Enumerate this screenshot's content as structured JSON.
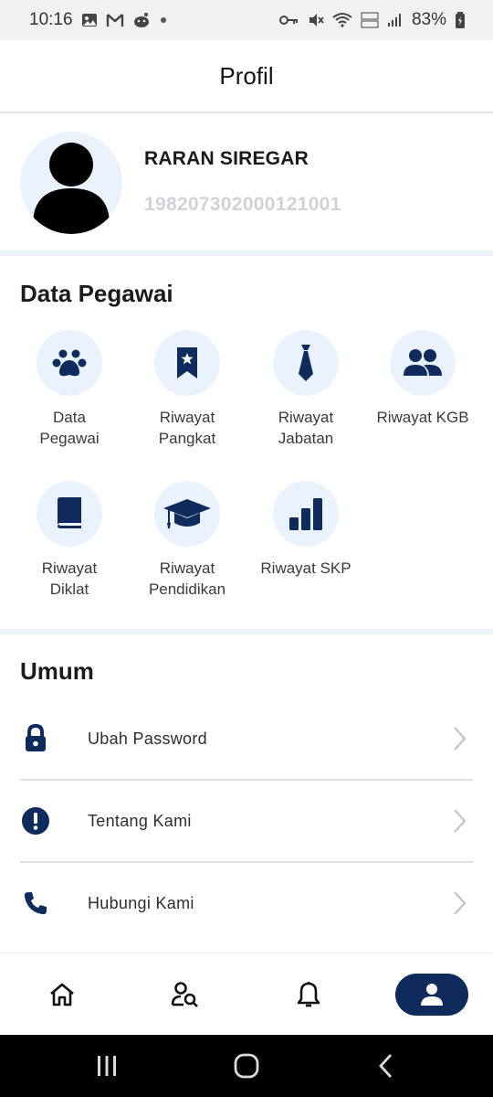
{
  "status_bar": {
    "time": "10:16",
    "battery": "83%",
    "icons_left": [
      "image-icon",
      "gmail-icon",
      "reddit-icon",
      "dot-icon"
    ],
    "icons_right": [
      "key-icon",
      "mute-icon",
      "wifi-icon",
      "volte-icon",
      "signal-icon",
      "battery-icon"
    ]
  },
  "header": {
    "title": "Profil"
  },
  "profile": {
    "name": "RARAN SIREGAR",
    "nip": "198207302000121001"
  },
  "data_pegawai": {
    "title": "Data Pegawai",
    "items": [
      {
        "label_line1": "Data",
        "label_line2": "Pegawai",
        "icon": "paw-icon"
      },
      {
        "label_line1": "Riwayat",
        "label_line2": "Pangkat",
        "icon": "bookmark-star-icon"
      },
      {
        "label_line1": "Riwayat",
        "label_line2": "Jabatan",
        "icon": "tie-icon"
      },
      {
        "label_line1": "Riwayat KGB",
        "label_line2": "",
        "icon": "users-icon"
      },
      {
        "label_line1": "Riwayat",
        "label_line2": "Diklat",
        "icon": "book-icon"
      },
      {
        "label_line1": "Riwayat",
        "label_line2": "Pendidikan",
        "icon": "graduation-cap-icon"
      },
      {
        "label_line1": "Riwayat SKP",
        "label_line2": "",
        "icon": "bar-chart-icon"
      }
    ]
  },
  "umum": {
    "title": "Umum",
    "items": [
      {
        "label": "Ubah Password",
        "icon": "lock-icon"
      },
      {
        "label": "Tentang Kami",
        "icon": "exclamation-circle-icon"
      },
      {
        "label": "Hubungi Kami",
        "icon": "phone-icon"
      }
    ]
  },
  "bottom_nav": {
    "items": [
      "home-icon",
      "user-search-icon",
      "bell-icon",
      "user-icon"
    ],
    "active": "user-icon"
  },
  "colors": {
    "primary": "#0f2a5c",
    "icon_bg": "#eaf2fe",
    "separator": "#edf3fc",
    "nip_text": "#cfd3d8"
  }
}
